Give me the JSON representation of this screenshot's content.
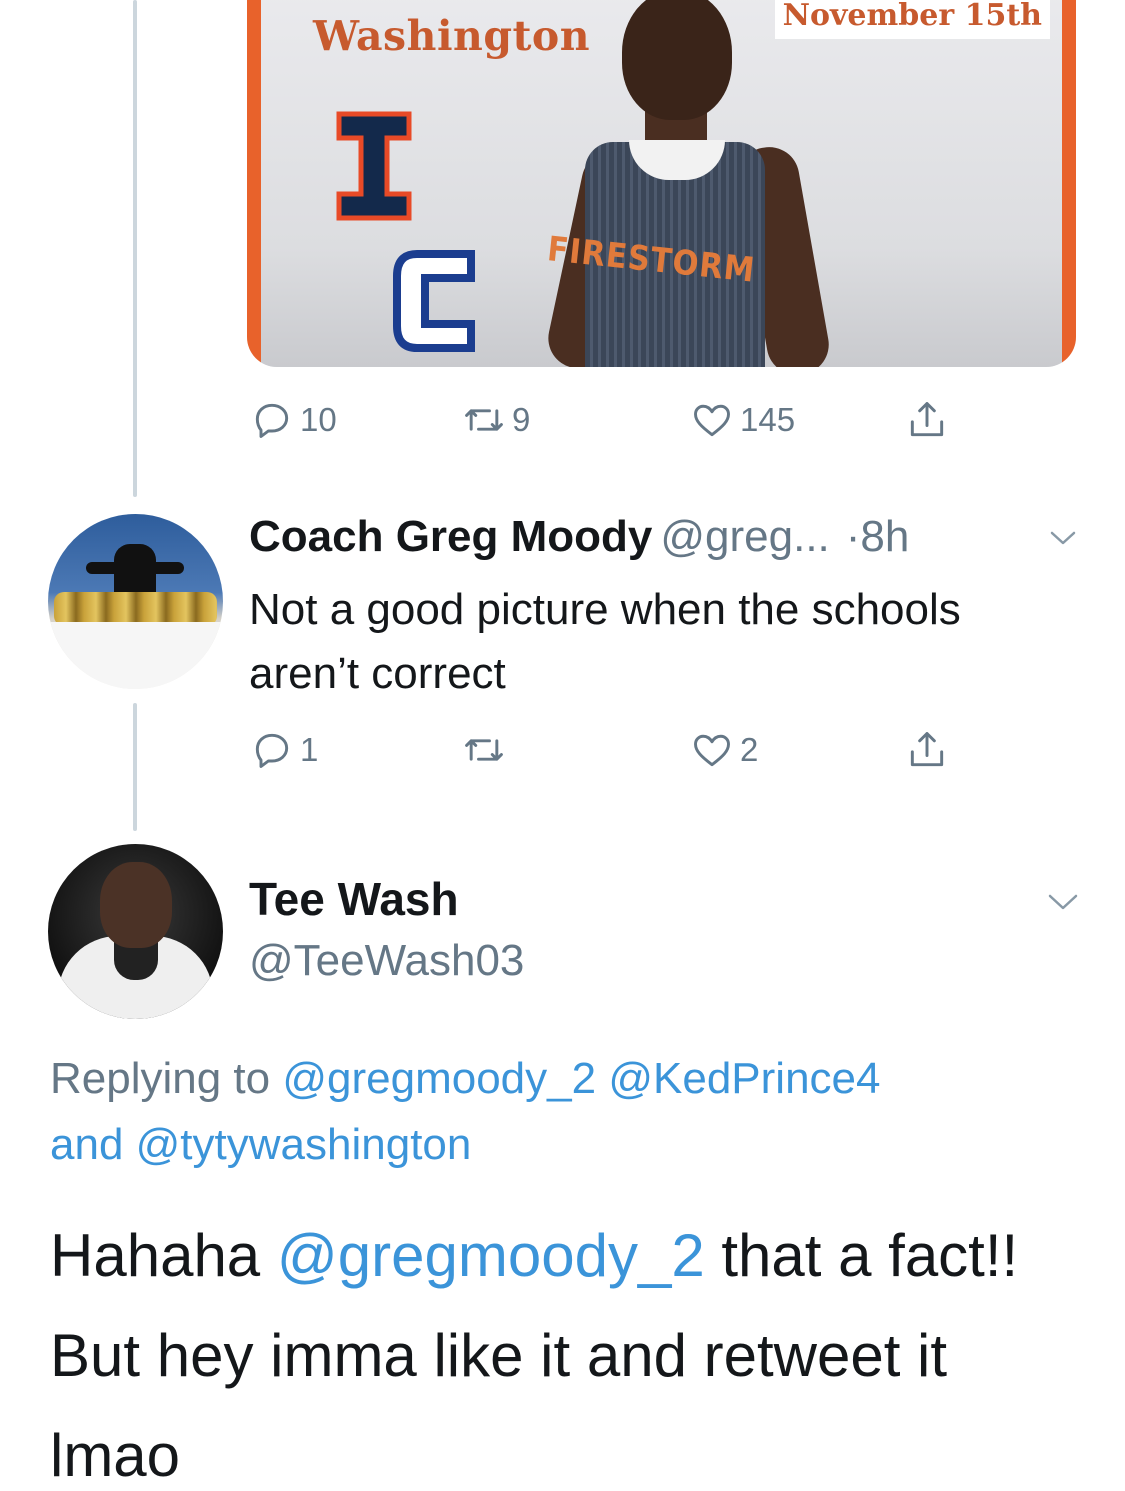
{
  "quoted_media": {
    "name_text": "Washington",
    "date_text": "November 15th",
    "jersey_text": "FIRESTORM"
  },
  "tweet1_actions": {
    "reply_count": "10",
    "retweet_count": "9",
    "like_count": "145"
  },
  "tweet2": {
    "display_name": "Coach Greg Moody",
    "handle": "@greg...",
    "time": "·8h",
    "body": "Not a good picture when the schools aren’t correct",
    "reply_count": "1",
    "retweet_count": "",
    "like_count": "2"
  },
  "tweet3": {
    "display_name": "Tee Wash",
    "handle": "@TeeWash03",
    "replying_prefix": "Replying to ",
    "replying_user1": "@gregmoody_2",
    "replying_user2": "@KedPrince4",
    "replying_and": "and ",
    "replying_user3": "@tytywashington",
    "body_start": "Hahaha ",
    "body_mention": "@gregmoody_2",
    "body_end": " that a fact!! But hey imma like it and retweet it lmao"
  },
  "colors": {
    "link": "#3b94d9",
    "secondary_text": "#657786",
    "thread_line": "#ccd6dd",
    "frame_orange": "#e8622b"
  }
}
